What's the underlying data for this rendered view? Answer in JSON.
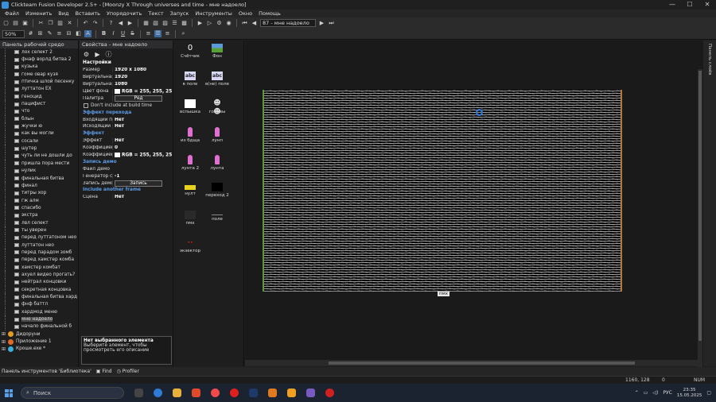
{
  "window": {
    "title": "Clickteam Fusion Developer 2.5+ - [Moonzy X  Through universes and time - мне надоело]",
    "min": "—",
    "max": "☐",
    "close": "✕"
  },
  "menu": [
    "Файл",
    "Изменить",
    "Вид",
    "Вставить",
    "Упорядочить",
    "Текст",
    "Запуск",
    "Инструменты",
    "Окно",
    "Помощь"
  ],
  "toolbar": {
    "zoom": "50%",
    "frame_select": "87 - мне надоело"
  },
  "workspace": {
    "header": "Панель рабочей средо",
    "frames": [
      "лох селект 2",
      "фнаф ворлд битва 2",
      "кузька",
      "гоме овар кузя",
      "птичка шлой песенку",
      "луттатон EX",
      "геноцид",
      "пацифист",
      "что",
      "блын",
      "жучки ю",
      "как вы могли",
      "сосали",
      "шутер",
      "чуть ли не дошли до",
      "пришла пора мести",
      "нулик",
      "финальная битва",
      "финал",
      "титры хор",
      "гж алм",
      "спасибо",
      "экстра",
      "лвл селект",
      "ты уверен",
      "перед луттатоном нео",
      "луттатон нео",
      "перед парадом зомб",
      "перед хамстер комба",
      "хамстер комбат",
      "ахуел видео прогать?",
      "нейтрал концовки",
      "секретная концовка",
      "финальная битва хард",
      "фнф баттл",
      "хардмод меню",
      "мне надоело",
      "начало финальной б"
    ],
    "selected_index": 36,
    "apps": [
      {
        "label": "Дидоруни",
        "color": "#e39b2a"
      },
      {
        "label": "Приложение 1",
        "color": "#e06a2a"
      },
      {
        "label": "Кроше.exe *",
        "color": "#3ab0e0"
      }
    ]
  },
  "properties": {
    "header": "Свойства - мне надоело",
    "rows": [
      {
        "type": "section",
        "text": "Настройки"
      },
      {
        "type": "row",
        "k": "Размер",
        "v": "1920 x 1080"
      },
      {
        "type": "row",
        "k": "Виртуальная ш",
        "v": "1920"
      },
      {
        "type": "row",
        "k": "Виртуальная в",
        "v": "1080"
      },
      {
        "type": "color",
        "k": "Цвет фона",
        "v": "RGB = 255, 255, 25"
      },
      {
        "type": "palette",
        "k": "Палитра",
        "v": "Ред"
      },
      {
        "type": "check",
        "text": "Don't include at build time"
      },
      {
        "type": "blue",
        "text": "Эффект перехода"
      },
      {
        "type": "row",
        "k": "Входящий пе",
        "v": "Нет"
      },
      {
        "type": "row",
        "k": "Исходящий пе",
        "v": "Нет"
      },
      {
        "type": "blue",
        "text": "Эффект"
      },
      {
        "type": "row",
        "k": "Эффект",
        "v": "Нет"
      },
      {
        "type": "row",
        "k": "Коэффициент",
        "v": "0"
      },
      {
        "type": "color",
        "k": "Коэффициент",
        "v": "RGB = 255, 255, 25"
      },
      {
        "type": "blue",
        "text": "Запись демо"
      },
      {
        "type": "row",
        "k": "Файл Демо",
        "v": ""
      },
      {
        "type": "row",
        "k": "Генератор сл",
        "v": "-1"
      },
      {
        "type": "palette",
        "k": "Запись демо",
        "v": "Запись"
      },
      {
        "type": "blue",
        "text": "Include another frame"
      },
      {
        "type": "row",
        "k": "Сцена",
        "v": "Нет"
      }
    ],
    "desc_title": "Нет выбранного элемента",
    "desc_text": "Выберите элемент, чтобы просмотреть его описание"
  },
  "objects": [
    {
      "label": "Счётчик",
      "icon": "counter-icon"
    },
    {
      "label": "Фон",
      "icon": "background-icon"
    },
    {
      "label": "в поле",
      "icon": "abc-text-icon"
    },
    {
      "label": "в(не) поле",
      "icon": "abc-text-icon"
    },
    {
      "label": "вспышка",
      "icon": "white-rect-icon"
    },
    {
      "label": "головы",
      "icon": "heads-icon"
    },
    {
      "label": "из бдща",
      "icon": "pink-sprite-icon"
    },
    {
      "label": "лунп",
      "icon": "pink-sprite-icon"
    },
    {
      "label": "лунта 2",
      "icon": "pink-sprite-icon"
    },
    {
      "label": "лунта",
      "icon": "pink-sprite-icon"
    },
    {
      "label": "нулт",
      "icon": "yellow-sprite-icon"
    },
    {
      "label": "переход 2",
      "icon": "black-rect-icon"
    },
    {
      "label": "пмх",
      "icon": "dark-rect-icon"
    },
    {
      "label": "поле",
      "icon": "line-icon"
    },
    {
      "label": "экзектор",
      "icon": "red-dots-icon"
    }
  ],
  "editor": {
    "canvas_label": "пмх",
    "side_label": "Панель слоёв"
  },
  "bottom_tabs": [
    "Панель инструментов 'Библиотека'",
    "Find",
    "Profiler"
  ],
  "status": {
    "coords": "1160, 128",
    "zoom_small": "0",
    "num": "NUM"
  },
  "taskbar": {
    "search": "Поиск",
    "lang": "РУС",
    "time": "23:35",
    "date": "15.05.2025"
  }
}
